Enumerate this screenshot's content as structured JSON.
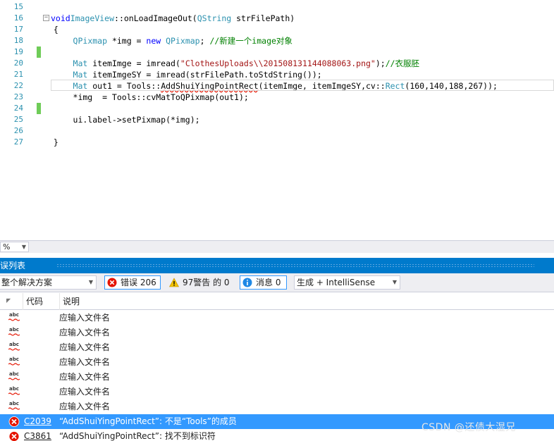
{
  "editor": {
    "lines": [
      {
        "n": "15",
        "chg": false,
        "tokens": []
      },
      {
        "n": "16",
        "chg": false,
        "fold": true,
        "tokens": [
          [
            "kw",
            "void"
          ],
          [
            "",
            "  "
          ],
          [
            "ty",
            "ImageView"
          ],
          [
            "",
            "::onLoadImageOut("
          ],
          [
            "ty",
            "QString"
          ],
          [
            "",
            " strFilePath)"
          ]
        ]
      },
      {
        "n": "17",
        "chg": false,
        "tokens": [
          [
            "",
            "  {"
          ]
        ]
      },
      {
        "n": "18",
        "chg": false,
        "tokens": [
          [
            "",
            "      "
          ],
          [
            "ty",
            "QPixmap"
          ],
          [
            "",
            " *img = "
          ],
          [
            "kw",
            "new"
          ],
          [
            "",
            " "
          ],
          [
            "ty",
            "QPixmap"
          ],
          [
            "",
            "; "
          ],
          [
            "cm",
            "//新建一个image对象"
          ]
        ]
      },
      {
        "n": "19",
        "chg": true,
        "tokens": []
      },
      {
        "n": "20",
        "chg": false,
        "tokens": [
          [
            "",
            "      "
          ],
          [
            "ty",
            "Mat"
          ],
          [
            "",
            " itemImge = imread("
          ],
          [
            "str",
            "\"ClothesUploads\\\\201508131144088063.png\""
          ],
          [
            "",
            ");"
          ],
          [
            "cm",
            "//衣服胚"
          ]
        ]
      },
      {
        "n": "21",
        "chg": false,
        "tokens": [
          [
            "",
            "      "
          ],
          [
            "ty",
            "Mat"
          ],
          [
            "",
            " itemImgeSY = imread(strFilePath.toStdString());"
          ]
        ]
      },
      {
        "n": "22",
        "chg": false,
        "tokens": [
          [
            "",
            "      "
          ],
          [
            "ty",
            "Mat"
          ],
          [
            "",
            " out1 = Tools::"
          ],
          [
            "sq",
            "AddShuiYingPointRect"
          ],
          [
            "",
            "(itemImge, itemImgeSY,cv::"
          ],
          [
            "ty",
            "Rect"
          ],
          [
            "",
            "(160,140,188,267));"
          ]
        ]
      },
      {
        "n": "23",
        "chg": false,
        "tokens": [
          [
            "",
            "      *img  = Tools::cvMatToQPixmap(out1);"
          ]
        ]
      },
      {
        "n": "24",
        "chg": true,
        "tokens": []
      },
      {
        "n": "25",
        "chg": false,
        "tokens": [
          [
            "",
            "      ui.label->setPixmap(*img);"
          ]
        ]
      },
      {
        "n": "26",
        "chg": false,
        "tokens": []
      },
      {
        "n": "27",
        "chg": false,
        "tokens": [
          [
            "",
            "  }"
          ]
        ]
      }
    ]
  },
  "zoom": {
    "value": "%"
  },
  "panel": {
    "title": "误列表",
    "scope_dropdown": "整个解决方案",
    "errors_filter": "错误 206",
    "warnings_filter": "97警告 的 0",
    "messages_filter": "消息 0",
    "source_dropdown": "生成 + IntelliSense",
    "columns": {
      "code": "代码",
      "description": "说明"
    },
    "rows": [
      {
        "kind": "spell",
        "code": "",
        "desc": "应输入文件名"
      },
      {
        "kind": "spell",
        "code": "",
        "desc": "应输入文件名"
      },
      {
        "kind": "spell",
        "code": "",
        "desc": "应输入文件名"
      },
      {
        "kind": "spell",
        "code": "",
        "desc": "应输入文件名"
      },
      {
        "kind": "spell",
        "code": "",
        "desc": "应输入文件名"
      },
      {
        "kind": "spell",
        "code": "",
        "desc": "应输入文件名"
      },
      {
        "kind": "spell",
        "code": "",
        "desc": "应输入文件名"
      },
      {
        "kind": "error",
        "code": "C2039",
        "desc": "“AddShuiYingPointRect”: 不是“Tools”的成员",
        "selected": true
      },
      {
        "kind": "error",
        "code": "C3861",
        "desc": "“AddShuiYingPointRect”: 找不到标识符"
      }
    ]
  },
  "colors": {
    "accent": "#007acc",
    "selection": "#3399ff",
    "error": "#e51400",
    "change_bar": "#6fcc58"
  },
  "watermark": "CSDN @还债大湿兄"
}
